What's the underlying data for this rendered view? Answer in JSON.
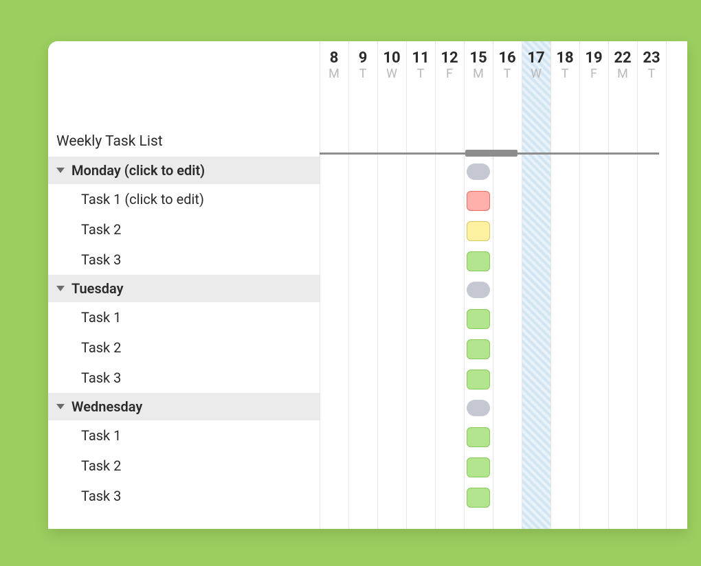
{
  "title": "Weekly Task List",
  "columns": [
    {
      "num": "8",
      "wd": "M"
    },
    {
      "num": "9",
      "wd": "T"
    },
    {
      "num": "10",
      "wd": "W"
    },
    {
      "num": "11",
      "wd": "T"
    },
    {
      "num": "12",
      "wd": "F"
    },
    {
      "num": "15",
      "wd": "M"
    },
    {
      "num": "16",
      "wd": "T"
    },
    {
      "num": "17",
      "wd": "W"
    },
    {
      "num": "18",
      "wd": "T"
    },
    {
      "num": "19",
      "wd": "F"
    },
    {
      "num": "22",
      "wd": "M"
    },
    {
      "num": "23",
      "wd": "T"
    }
  ],
  "today_index": 7,
  "groups": [
    {
      "label": "Monday (click to edit)",
      "tasks": [
        {
          "label": "Task 1 (click to edit)",
          "status": "red"
        },
        {
          "label": "Task 2",
          "status": "yellow"
        },
        {
          "label": "Task 3",
          "status": "green"
        }
      ]
    },
    {
      "label": "Tuesday",
      "tasks": [
        {
          "label": "Task 1",
          "status": "green"
        },
        {
          "label": "Task 2",
          "status": "green"
        },
        {
          "label": "Task 3",
          "status": "green"
        }
      ]
    },
    {
      "label": "Wednesday",
      "tasks": [
        {
          "label": "Task 1",
          "status": "green"
        },
        {
          "label": "Task 2",
          "status": "green"
        },
        {
          "label": "Task 3",
          "status": "green"
        }
      ]
    }
  ],
  "task_column_index": 5,
  "summary_range": [
    5,
    6
  ]
}
